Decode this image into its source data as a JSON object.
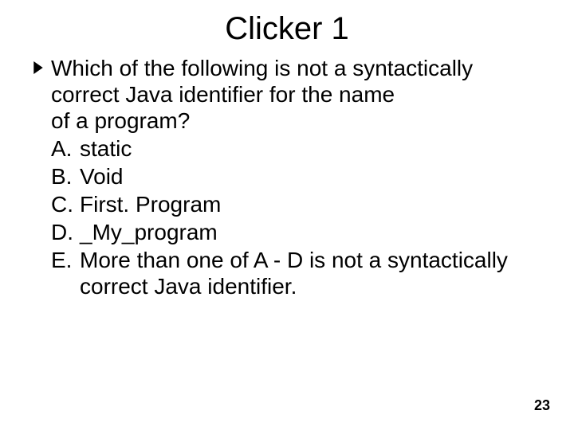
{
  "title": "Clicker 1",
  "question": {
    "line1": "Which of the following is not a syntactically",
    "line2": "correct Java identifier for the name",
    "line3": "of a program?"
  },
  "options": {
    "a": {
      "label": "A.",
      "text": "static"
    },
    "b": {
      "label": "B.",
      "text": "Void"
    },
    "c": {
      "label": "C.",
      "text": "First. Program"
    },
    "d": {
      "label": "D.",
      "text": "_My_program"
    },
    "e": {
      "label": "E.",
      "line1": "More than one of A - D is not a syntactically",
      "line2": "correct Java identifier."
    }
  },
  "page_number": "23"
}
